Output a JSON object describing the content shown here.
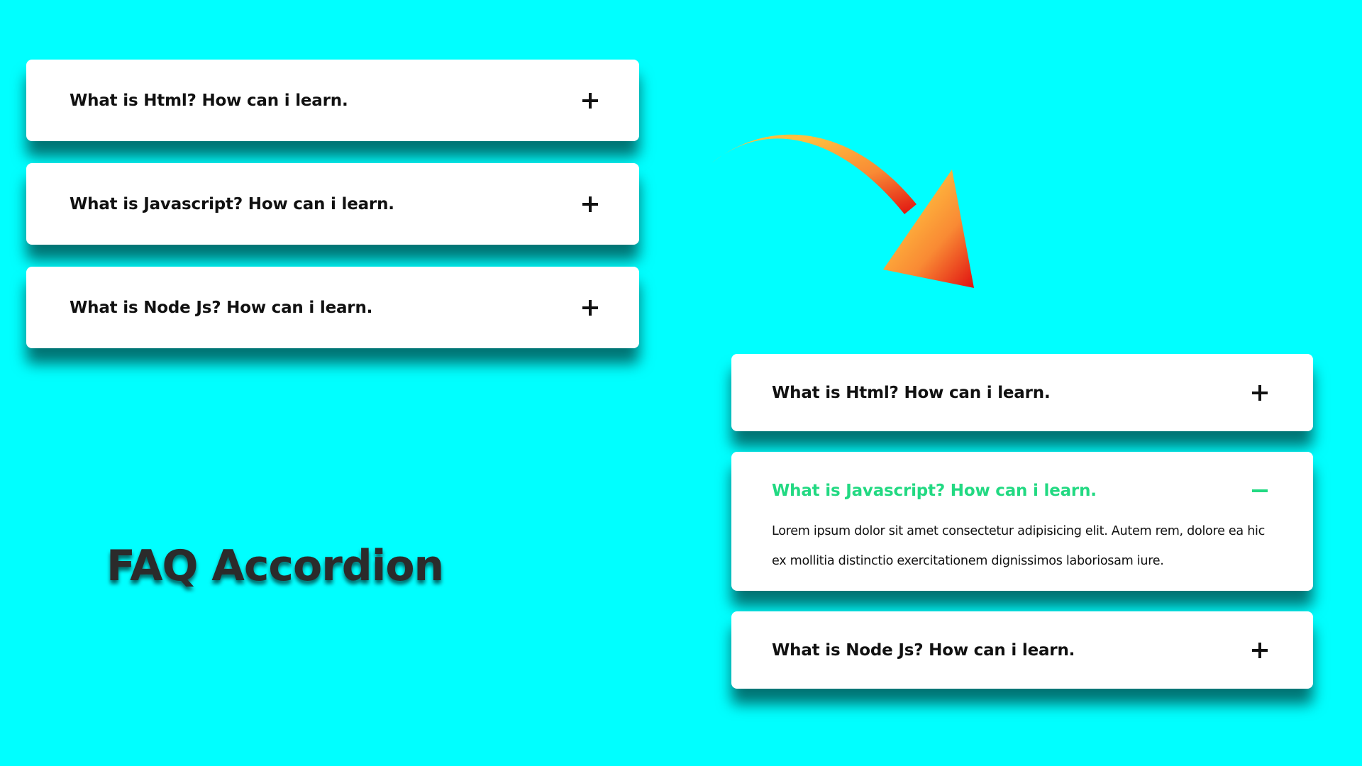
{
  "heading": "FAQ Accordion",
  "colors": {
    "background": "#00ffff",
    "card": "#ffffff",
    "question_text": "#111111",
    "active_text": "#22d982",
    "arrow_start": "#ffbf3f",
    "arrow_end": "#e01010"
  },
  "collapsed_demo": {
    "items": [
      {
        "question": "What is Html? How can i learn.",
        "icon": "plus-icon"
      },
      {
        "question": "What is Javascript? How can i learn.",
        "icon": "plus-icon"
      },
      {
        "question": "What is Node Js? How can i learn.",
        "icon": "plus-icon"
      }
    ]
  },
  "expanded_demo": {
    "items": [
      {
        "question": "What is Html? How can i learn.",
        "icon": "plus-icon",
        "open": false
      },
      {
        "question": "What is Javascript? How can i learn.",
        "icon": "minus-icon",
        "open": true,
        "answer": "Lorem ipsum dolor sit amet consectetur adipisicing elit. Autem rem, dolore ea hic ex mollitia distinctio exercitationem dignissimos laboriosam iure."
      },
      {
        "question": "What is Node Js? How can i learn.",
        "icon": "plus-icon",
        "open": false
      }
    ]
  },
  "decoration": {
    "arrow_icon": "curved-arrow-icon"
  }
}
